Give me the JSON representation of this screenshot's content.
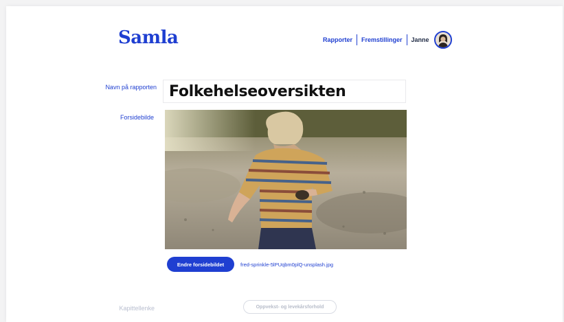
{
  "app": {
    "logo": "Samla"
  },
  "nav": {
    "items": [
      {
        "label": "Rapporter"
      },
      {
        "label": "Fremstillinger"
      }
    ],
    "user": "Janne",
    "avatar_icon": "user-avatar-icon"
  },
  "form": {
    "name_label": "Navn på rapporten",
    "name_value": "Folkehelseoversikten",
    "cover_label": "Forsidebilde",
    "change_cover_button": "Endre forsidebildet",
    "cover_filename": "fred-sprinkle-5lPUqbm0plQ-unsplash.jpg",
    "chapter_label": "Kapittellenke",
    "chapter_chip": "Oppvekst- og levekårsforhold"
  },
  "colors": {
    "brand": "#1f3fd1",
    "text": "#111111",
    "muted": "#b9bfd0"
  }
}
